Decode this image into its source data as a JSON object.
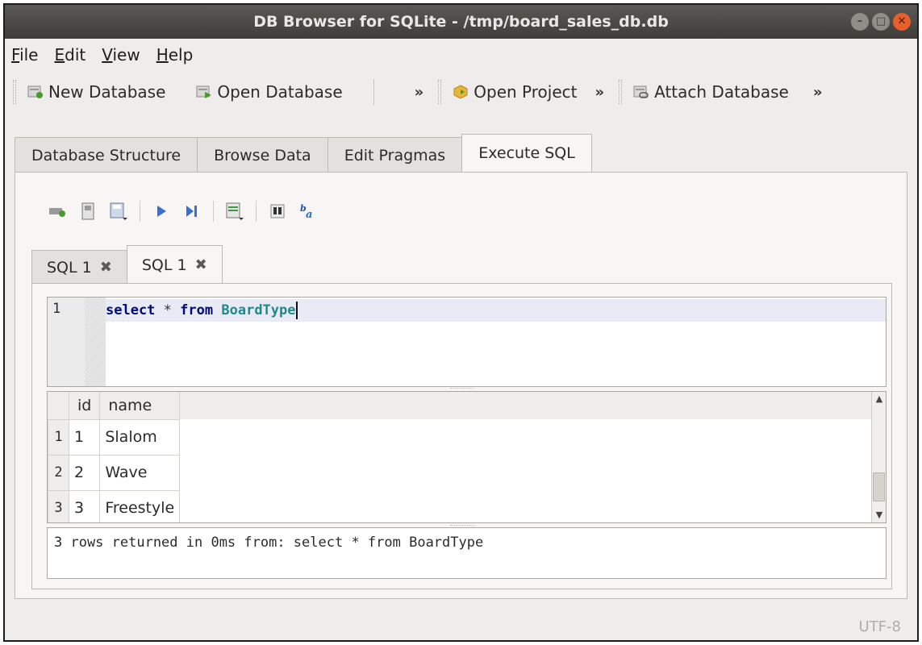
{
  "window": {
    "title": "DB Browser for SQLite - /tmp/board_sales_db.db"
  },
  "menu": [
    "File",
    "Edit",
    "View",
    "Help"
  ],
  "menu_access_keys": [
    "F",
    "E",
    "V",
    "H"
  ],
  "toolbar": {
    "new_database": "New Database",
    "open_database": "Open Database",
    "open_project": "Open Project",
    "attach_database": "Attach Database",
    "overflow": "»"
  },
  "main_tabs": [
    "Database Structure",
    "Browse Data",
    "Edit Pragmas",
    "Execute SQL"
  ],
  "sql_tabs": [
    "SQL 1",
    "SQL 1"
  ],
  "editor": {
    "line_number": "1",
    "tokens": {
      "select": "select",
      "star": "*",
      "from": "from",
      "table": "BoardType"
    }
  },
  "results": {
    "columns": [
      "id",
      "name"
    ],
    "row_numbers": [
      "1",
      "2",
      "3"
    ],
    "rows": [
      [
        "1",
        "Slalom"
      ],
      [
        "2",
        "Wave"
      ],
      [
        "3",
        "Freestyle"
      ]
    ]
  },
  "message": "3 rows returned in 0ms from: select * from BoardType",
  "status": {
    "encoding": "UTF-8"
  },
  "colors": {
    "title_bg": "#3e3d39",
    "close_btn": "#e85e2c",
    "keyword": "#000a7f",
    "identifier": "#1f8a8a"
  }
}
